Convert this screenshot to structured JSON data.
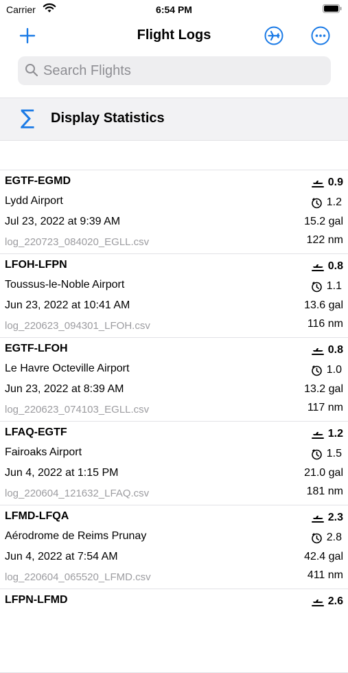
{
  "status_bar": {
    "carrier": "Carrier",
    "time": "6:54 PM"
  },
  "nav": {
    "title": "Flight Logs",
    "add_icon": "plus-icon",
    "plane_icon": "airplane-circle-icon",
    "more_icon": "ellipsis-circle-icon",
    "accent": "#1a7ae6"
  },
  "search": {
    "placeholder": "Search Flights",
    "icon": "search-icon"
  },
  "stats": {
    "icon_glyph": "∑",
    "label": "Display Statistics"
  },
  "flights": [
    {
      "route": "EGTF-EGMD",
      "airport": "Lydd Airport",
      "date": "Jul 23, 2022 at 9:39 AM",
      "file": "log_220723_084020_EGLL.csv",
      "flight_time": "0.9",
      "block_time": "1.2",
      "fuel": "15.2 gal",
      "distance": "122 nm"
    },
    {
      "route": "LFOH-LFPN",
      "airport": "Toussus-le-Noble Airport",
      "date": "Jun 23, 2022 at 10:41 AM",
      "file": "log_220623_094301_LFOH.csv",
      "flight_time": "0.8",
      "block_time": "1.1",
      "fuel": "13.6 gal",
      "distance": "116 nm"
    },
    {
      "route": "EGTF-LFOH",
      "airport": "Le Havre Octeville Airport",
      "date": "Jun 23, 2022 at 8:39 AM",
      "file": "log_220623_074103_EGLL.csv",
      "flight_time": "0.8",
      "block_time": "1.0",
      "fuel": "13.2 gal",
      "distance": "117 nm"
    },
    {
      "route": "LFAQ-EGTF",
      "airport": "Fairoaks Airport",
      "date": "Jun 4, 2022 at 1:15 PM",
      "file": "log_220604_121632_LFAQ.csv",
      "flight_time": "1.2",
      "block_time": "1.5",
      "fuel": "21.0 gal",
      "distance": "181 nm"
    },
    {
      "route": "LFMD-LFQA",
      "airport": "Aérodrome de Reims Prunay",
      "date": "Jun 4, 2022 at 7:54 AM",
      "file": "log_220604_065520_LFMD.csv",
      "flight_time": "2.3",
      "block_time": "2.8",
      "fuel": "42.4 gal",
      "distance": "411 nm"
    },
    {
      "route": "LFPN-LFMD",
      "airport": "",
      "date": "",
      "file": "",
      "flight_time": "2.6",
      "block_time": "",
      "fuel": "",
      "distance": ""
    }
  ]
}
